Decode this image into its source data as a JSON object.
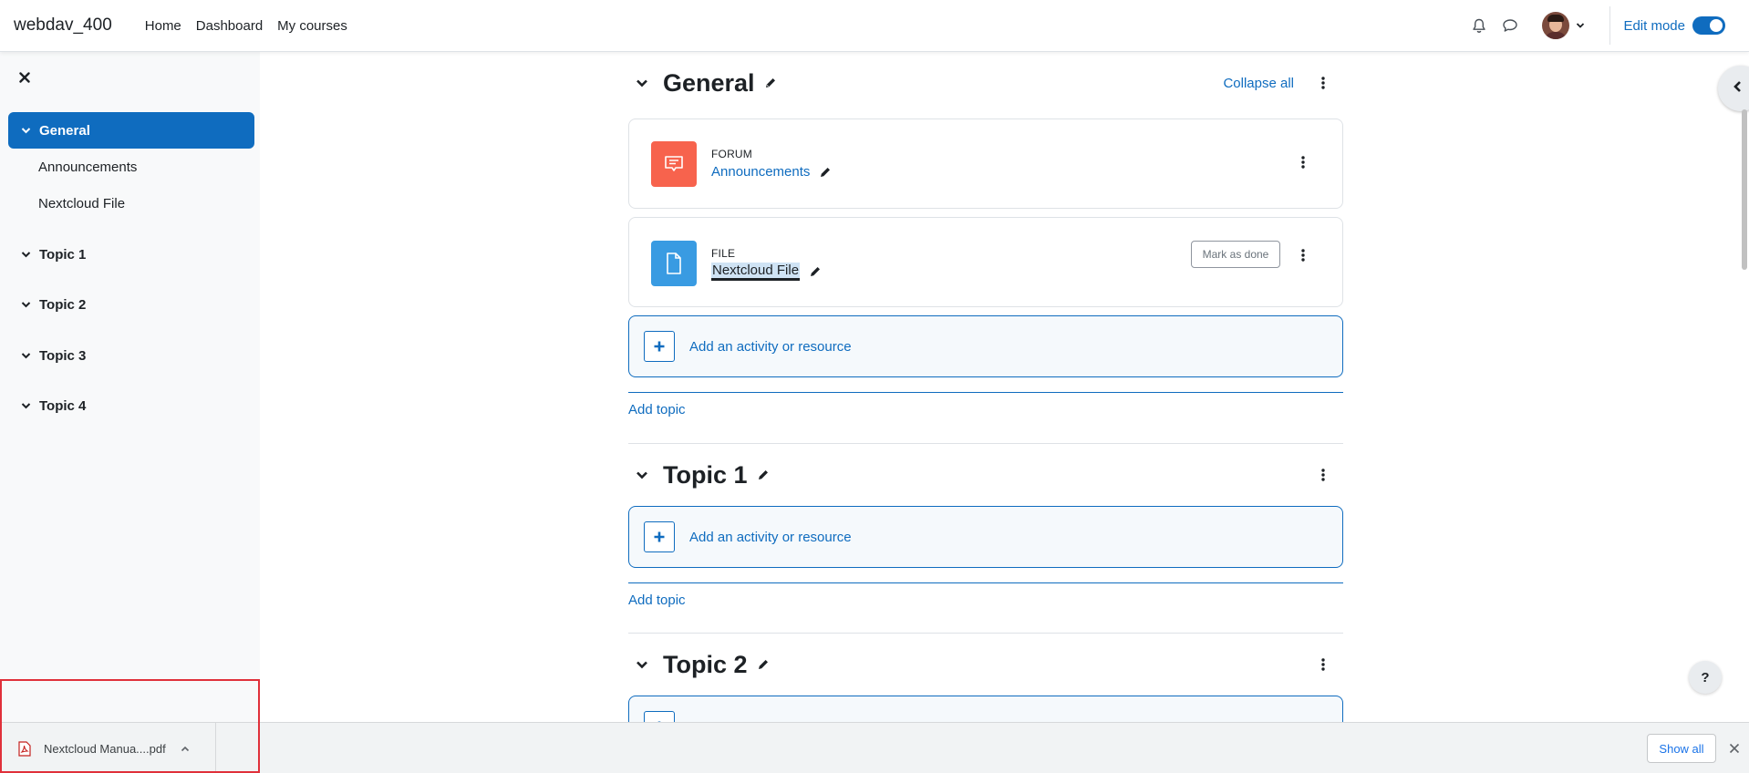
{
  "navbar": {
    "brand": "webdav_400",
    "links": [
      "Home",
      "Dashboard",
      "My courses"
    ],
    "edit_mode_label": "Edit mode",
    "edit_mode_on": true
  },
  "course_index": {
    "items": [
      {
        "label": "General",
        "active": true,
        "children": [
          "Announcements",
          "Nextcloud File"
        ]
      },
      {
        "label": "Topic 1",
        "active": false
      },
      {
        "label": "Topic 2",
        "active": false
      },
      {
        "label": "Topic 3",
        "active": false
      },
      {
        "label": "Topic 4",
        "active": false
      }
    ]
  },
  "sections": [
    {
      "title": "General",
      "collapse_all": "Collapse all",
      "activities": [
        {
          "type": "FORUM",
          "name": "Announcements",
          "icon": "forum-icon",
          "color": "#f7634d"
        },
        {
          "type": "FILE",
          "name": "Nextcloud File",
          "icon": "file-icon",
          "color": "#399be2",
          "completion_button": "Mark as done"
        }
      ],
      "add_activity": "Add an activity or resource",
      "add_topic": "Add topic"
    },
    {
      "title": "Topic 1",
      "add_activity": "Add an activity or resource",
      "add_topic": "Add topic"
    },
    {
      "title": "Topic 2"
    }
  ],
  "help_button": "?",
  "download_bar": {
    "file_name": "Nextcloud Manua....pdf",
    "show_all": "Show all"
  },
  "colors": {
    "accent": "#0f6cbf",
    "forum": "#f7634d",
    "file": "#399be2",
    "highlight": "#e0303a"
  }
}
